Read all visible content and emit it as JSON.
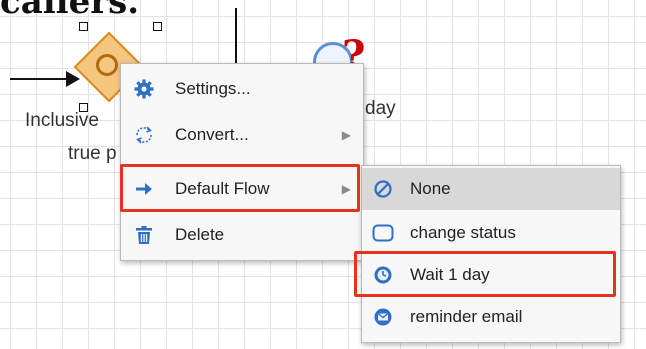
{
  "canvas": {
    "heading_fragment": "callers.",
    "gateway_label_line1": "Inclusive",
    "gateway_label_line2": "true p",
    "event_label_fragment": "day"
  },
  "context_menu": {
    "items": [
      {
        "label": "Settings...",
        "icon": "gear-icon",
        "has_submenu": false
      },
      {
        "label": "Convert...",
        "icon": "convert-icon",
        "has_submenu": true
      },
      {
        "label": "Default Flow",
        "icon": "arrow-right-icon",
        "has_submenu": true,
        "highlighted": true
      },
      {
        "label": "Delete",
        "icon": "trash-icon",
        "has_submenu": false
      }
    ]
  },
  "default_flow_submenu": {
    "items": [
      {
        "label": "None",
        "icon": "none-icon",
        "selected": true
      },
      {
        "label": "change status",
        "icon": "task-icon"
      },
      {
        "label": "Wait 1 day",
        "icon": "timer-icon",
        "highlighted": true
      },
      {
        "label": "reminder email",
        "icon": "email-icon"
      }
    ]
  },
  "colors": {
    "highlight_border": "#e8321f",
    "gateway_fill": "#f6c57e",
    "icon_blue": "#2f6fc4"
  }
}
